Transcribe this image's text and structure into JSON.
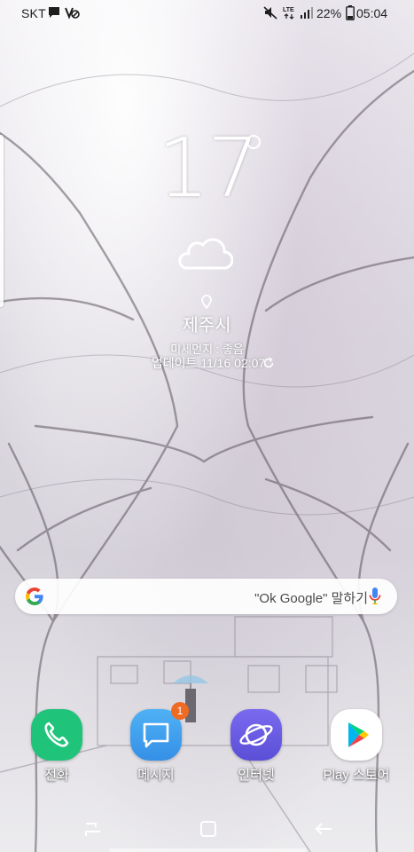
{
  "status_bar": {
    "carrier": "SKT",
    "battery_percent": "22%",
    "time": "05:04",
    "icons": [
      "chat-bubble-icon",
      "blocked-icon",
      "mute-icon",
      "lte-icon",
      "signal-icon",
      "battery-icon"
    ]
  },
  "weather": {
    "temperature": "17",
    "condition_icon": "cloud-icon",
    "city": "제주시",
    "condition": "미세먼지 : 좋음",
    "updated": "업데이트 11/16 02:07"
  },
  "search": {
    "hint": "\"Ok Google\" 말하기",
    "icons": [
      "google-g-icon",
      "mic-icon"
    ]
  },
  "dock": {
    "apps": [
      {
        "label": "전화",
        "icon": "phone-icon",
        "color": "#1fc47a"
      },
      {
        "label": "메시지",
        "icon": "message-icon",
        "color": "#3fa2f0",
        "badge": "1"
      },
      {
        "label": "인터넷",
        "icon": "internet-planet-icon",
        "color": "#6a5fe3"
      },
      {
        "label": "Play 스토어",
        "icon": "play-store-icon",
        "color": "#ffffff"
      }
    ]
  },
  "nav": {
    "buttons": [
      "recents-icon",
      "home-icon",
      "back-icon"
    ]
  }
}
